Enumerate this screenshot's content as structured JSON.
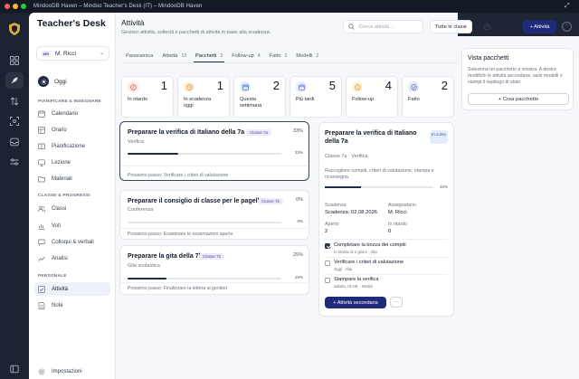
{
  "window": {
    "title": "MindooDB Haven – Mindoo Teacher's Desk (IT) – MindooDB Haven"
  },
  "sidebar": {
    "app_title": "Teacher's Desk",
    "user": {
      "initials": "MR",
      "name": "M. Ricci"
    },
    "today_label": "Oggi",
    "sections": [
      {
        "heading": "PIANIFICARE & INSEGNARE",
        "items": [
          "Calendario",
          "Orario",
          "Pianificazione",
          "Lezione",
          "Materiali"
        ]
      },
      {
        "heading": "CLASSE & PROGRESSI",
        "items": [
          "Classi",
          "Voti",
          "Colloqui & verbali",
          "Analisi"
        ]
      },
      {
        "heading": "PERSONALE",
        "items": [
          "Attività",
          "Note"
        ]
      }
    ],
    "settings_label": "Impostazioni"
  },
  "header": {
    "title": "Attività",
    "subtitle": "Gestisci attività, solleciti e pacchetti di attività in base alla scadenza.",
    "search_placeholder": "Cerca attività...",
    "class_filter": "Tutte le classi",
    "package_button": "Pacchetto",
    "new_button": "+ Attività",
    "help": "?"
  },
  "tabs": [
    {
      "label": "Panoramica",
      "count": ""
    },
    {
      "label": "Attività",
      "count": "13"
    },
    {
      "label": "Pacchetti",
      "count": "3"
    },
    {
      "label": "Follow-up",
      "count": "4"
    },
    {
      "label": "Fatto",
      "count": "2"
    },
    {
      "label": "Modelli",
      "count": "2"
    }
  ],
  "stats": [
    {
      "label": "In ritardo",
      "value": "1",
      "color": "#e0504a",
      "bg": "#fde8e7"
    },
    {
      "label": "In scadenza oggi",
      "value": "1",
      "color": "#e07a1f",
      "bg": "#fdeedd"
    },
    {
      "label": "Questa settimana",
      "value": "2",
      "color": "#3a55c8",
      "bg": "#e4eafc"
    },
    {
      "label": "Più tardi",
      "value": "5",
      "color": "#5560c8",
      "bg": "#e9eafb"
    },
    {
      "label": "Follow-up",
      "value": "4",
      "color": "#d9961a",
      "bg": "#fdf1d8"
    },
    {
      "label": "Fatto",
      "value": "2",
      "color": "#4a5fb0",
      "bg": "#e6eaf7"
    }
  ],
  "packages": [
    {
      "title": "Preparare la verifica di Italiano della 7a",
      "class": "Classe 7a",
      "type": "Verifica",
      "progress": 33,
      "next_step": "Prossimo passo: Verificare i criteri di valutazione"
    },
    {
      "title": "Preparare il consiglio di classe per le pagelle",
      "class": "Classe 7b",
      "type": "Conferenza",
      "progress": 0,
      "next_step": "Prossimo passo: Esaminare le osservazioni aperte"
    },
    {
      "title": "Preparare la gita della 7b",
      "class": "Classe 7b",
      "type": "Gita scolastica",
      "progress": 25,
      "next_step": "Prossimo passo: Finalizzare la lettera ai genitori"
    }
  ],
  "detail": {
    "title": "Preparare la verifica di Italiano della 7a",
    "status": "In corso",
    "meta": "Classe 7a · Verifica",
    "description": "Raccogliere compiti, criteri di valutazione, stampa e riconsegna.",
    "progress": 33,
    "due_label": "Scadenza",
    "due_value": "Scadenza: 02.08.2026",
    "assigned_label": "Assegnatario",
    "assigned_value": "M. Ricci",
    "open_label": "Aperto",
    "open_value": "2",
    "late_label": "In ritardo",
    "late_value": "0",
    "steps": [
      {
        "title": "Completare la bozza dei compiti",
        "sub": "In ritardo di 2 giorni · Alta",
        "done": true
      },
      {
        "title": "Verificare i criteri di valutazione",
        "sub": "Oggi · Alta",
        "done": false
      },
      {
        "title": "Stampare la verifica",
        "sub": "sabato, 01.08. · Media",
        "done": false
      }
    ],
    "secondary_button": "+ Attività secondaria",
    "more_button": "···"
  },
  "right_panel": {
    "title": "Vista pacchetti",
    "description": "Seleziona un pacchetto a sinistra. A destra modifichi le attività secondarie, salvi modelli o stampi il riepilogo di stato.",
    "create_button": "+ Crea pacchetto"
  }
}
